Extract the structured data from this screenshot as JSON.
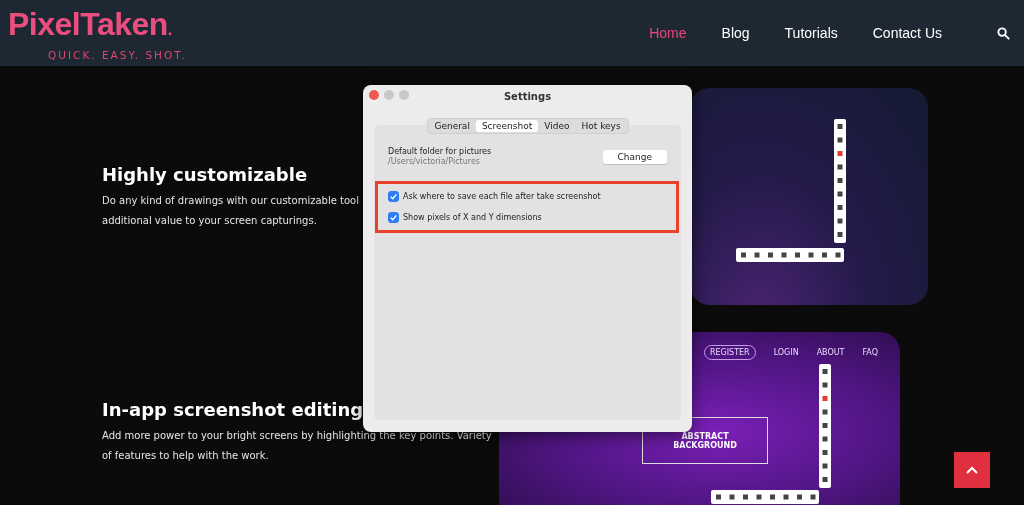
{
  "header": {
    "logo": {
      "name": "PixelTaken",
      "dot": ".",
      "tagline": "QUICK. EASY. SHOT."
    },
    "nav": [
      {
        "label": "Home",
        "selected": true
      },
      {
        "label": "Blog",
        "selected": false
      },
      {
        "label": "Tutorials",
        "selected": false
      },
      {
        "label": "Contact Us",
        "selected": false
      }
    ]
  },
  "features": [
    {
      "title": "Highly customizable",
      "lines": [
        "Do any kind of drawings with our customizable tool",
        "additional value to your screen capturings."
      ]
    },
    {
      "title": "In-app screenshot editing",
      "lines": [
        "Add more power to your bright screens by highlighting the key points. Variety",
        "of features to help with the work."
      ]
    }
  ],
  "mockups": [
    {
      "kind": "space"
    },
    {
      "kind": "abstract",
      "nav": [
        "REGISTER",
        "LOGIN",
        "ABOUT",
        "FAQ"
      ],
      "banner": [
        "ABSTRACT",
        "BACKGROUND"
      ]
    }
  ],
  "settings_dialog": {
    "title": "Settings",
    "tabs": [
      {
        "label": "General",
        "selected": false
      },
      {
        "label": "Screenshot",
        "selected": true
      },
      {
        "label": "Video",
        "selected": false
      },
      {
        "label": "Hot keys",
        "selected": false
      }
    ],
    "folder": {
      "label": "Default folder for pictures",
      "path": "/Users/victoria/Pictures",
      "button": "Change"
    },
    "highlighted": true,
    "options": [
      {
        "label": "Ask where to save each file after take screenshot",
        "checked": true
      },
      {
        "label": "Show pixels of X and Y dimensions",
        "checked": true
      }
    ]
  }
}
